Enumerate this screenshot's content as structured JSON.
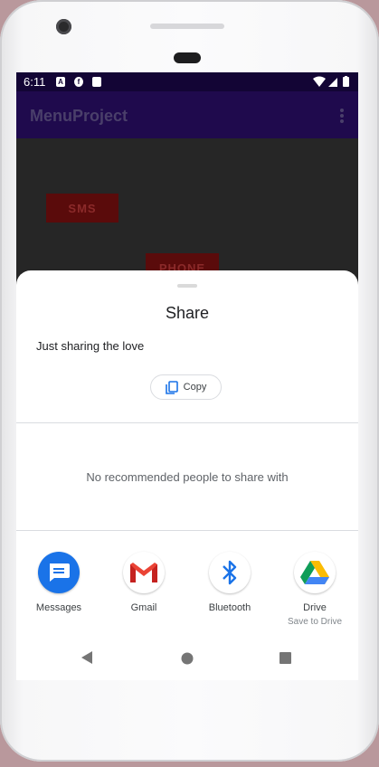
{
  "status_bar": {
    "time": "6:11",
    "icons": [
      "a-icon",
      "feedly-icon",
      "sd-card-icon",
      "wifi-icon",
      "signal-icon",
      "battery-icon"
    ]
  },
  "app_bar": {
    "title": "MenuProject",
    "overflow_icon": "more-vert-icon"
  },
  "content": {
    "sms_button": "SMS",
    "phone_button": "PHONE"
  },
  "share_sheet": {
    "title": "Share",
    "shared_text": "Just sharing the love",
    "copy_label": "Copy",
    "no_recommendations": "No recommended people to share with",
    "apps": [
      {
        "label": "Messages",
        "icon": "messages-icon"
      },
      {
        "label": "Gmail",
        "icon": "gmail-icon"
      },
      {
        "label": "Bluetooth",
        "icon": "bluetooth-icon"
      },
      {
        "label": "Drive",
        "sublabel": "Save to Drive",
        "icon": "drive-icon"
      }
    ]
  },
  "nav_bar": {
    "icons": [
      "back-icon",
      "home-icon",
      "recents-icon"
    ]
  },
  "colors": {
    "status_bar": "#130535",
    "app_bar": "#1f0a4d",
    "button_bg": "#5a0b0b",
    "messages_blue": "#1a73e8"
  }
}
